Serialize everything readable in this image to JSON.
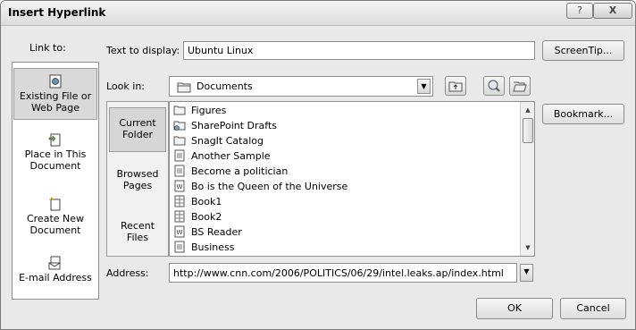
{
  "window": {
    "title": "Insert Hyperlink",
    "help_glyph": "?",
    "close_glyph": "X"
  },
  "link_to": {
    "label": "Link to:",
    "items": [
      {
        "label": "Existing File or Web Page",
        "icon": "globe-page-icon",
        "selected": true
      },
      {
        "label": "Place in This Document",
        "icon": "document-bookmark-icon",
        "selected": false
      },
      {
        "label": "Create New Document",
        "icon": "new-document-icon",
        "selected": false
      },
      {
        "label": "E-mail Address",
        "icon": "envelope-icon",
        "selected": false
      }
    ]
  },
  "text_to_display": {
    "label": "Text to display:",
    "value": "Ubuntu Linux"
  },
  "buttons": {
    "screentip": "ScreenTip...",
    "bookmark": "Bookmark...",
    "ok": "OK",
    "cancel": "Cancel"
  },
  "look_in": {
    "label": "Look in:",
    "value": "Documents",
    "icon": "folder-icon"
  },
  "nav": [
    {
      "label": "Current Folder",
      "selected": true
    },
    {
      "label": "Browsed Pages",
      "selected": false
    },
    {
      "label": "Recent Files",
      "selected": false
    }
  ],
  "files": [
    {
      "name": "Figures",
      "icon": "folder-icon"
    },
    {
      "name": "SharePoint Drafts",
      "icon": "sharepoint-folder-icon"
    },
    {
      "name": "SnagIt Catalog",
      "icon": "folder-icon"
    },
    {
      "name": "Another Sample",
      "icon": "document-icon"
    },
    {
      "name": "Become a politician",
      "icon": "document-icon"
    },
    {
      "name": "Bo is the Queen of the Universe",
      "icon": "word-document-icon"
    },
    {
      "name": "Book1",
      "icon": "excel-workbook-icon"
    },
    {
      "name": "Book2",
      "icon": "excel-workbook-icon"
    },
    {
      "name": "BS Reader",
      "icon": "word-document-icon"
    },
    {
      "name": "Business",
      "icon": "document-icon"
    }
  ],
  "address": {
    "label": "Address:",
    "value": "http://www.cnn.com/2006/POLITICS/06/29/intel.leaks.ap/index.html"
  }
}
